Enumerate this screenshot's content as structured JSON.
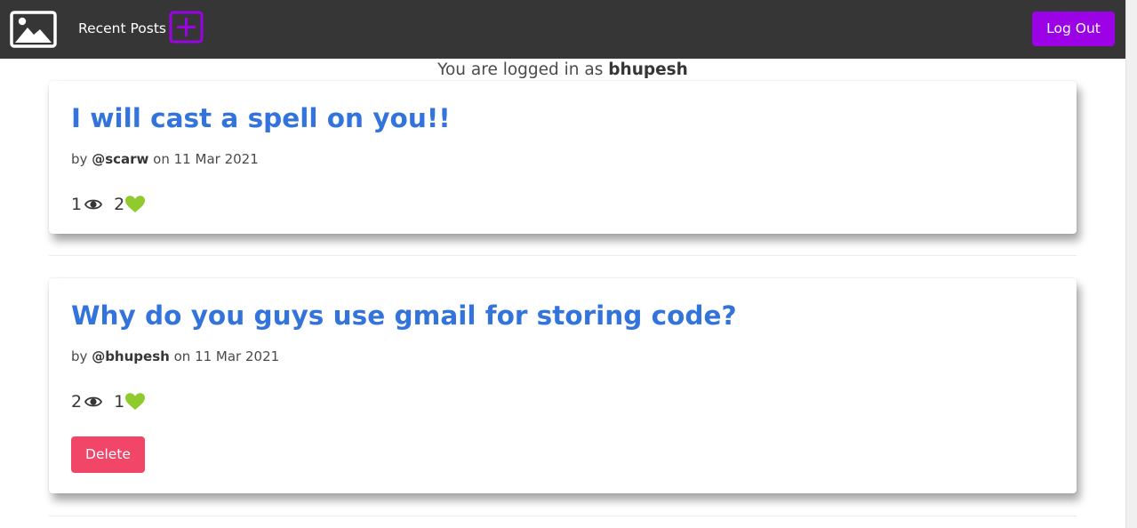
{
  "header": {
    "logo_icon": "image-icon",
    "nav_link": "Recent Posts",
    "new_post_icon": "plus-square-icon",
    "logout_label": "Log Out",
    "accent_color": "#9b03e6"
  },
  "session": {
    "prefix": "You are logged in as",
    "username": "bhupesh"
  },
  "posts": [
    {
      "title": "I will cast a spell on you!!",
      "by": "by",
      "author": "@scarw",
      "on": "on",
      "date": "11 Mar 2021",
      "views": "1",
      "likes": "2"
    },
    {
      "title": "Why do you guys use gmail for storing code?",
      "by": "by",
      "author": "@bhupesh",
      "on": "on",
      "date": "11 Mar 2021",
      "views": "2",
      "likes": "1",
      "delete_label": "Delete"
    }
  ],
  "icons": {
    "views": "eye-icon",
    "likes": "heart-icon"
  },
  "colors": {
    "title": "#3273dc",
    "delete": "#f14668",
    "heart": "#8fcb2c",
    "navbar": "#363636"
  }
}
